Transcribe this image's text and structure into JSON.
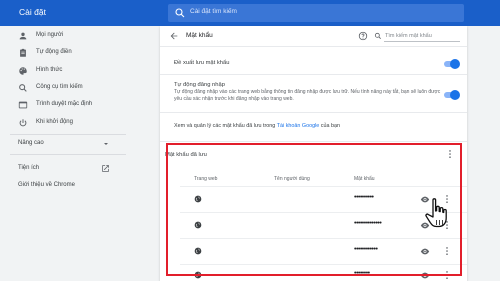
{
  "app": {
    "title": "Cài đặt"
  },
  "search": {
    "placeholder": "Cài đặt tìm kiếm"
  },
  "sidebar": {
    "items": [
      {
        "label": "Mọi người",
        "icon": "person-icon"
      },
      {
        "label": "Tự động điền",
        "icon": "clipboard-icon"
      },
      {
        "label": "Hình thức",
        "icon": "palette-icon"
      },
      {
        "label": "Công cụ tìm kiếm",
        "icon": "search-icon"
      },
      {
        "label": "Trình duyệt mặc định",
        "icon": "browser-icon"
      },
      {
        "label": "Khi khởi động",
        "icon": "power-icon"
      }
    ],
    "advanced": "Nâng cao",
    "extensions": "Tiện ích",
    "about": "Giới thiệu về Chrome"
  },
  "passwords": {
    "title": "Mật khẩu",
    "search_placeholder": "Tìm kiếm mật khẩu",
    "offer_save": "Đề xuất lưu mật khẩu",
    "auto_signin": "Tự động đăng nhập",
    "auto_signin_desc": "Tự động đăng nhập vào các trang web bằng thông tin đăng nhập được lưu trữ. Nếu tính năng này tắt, bạn sẽ luôn được yêu cầu xác nhận trước khi đăng nhập vào trang web.",
    "manage_prefix": "Xem và quản lý các mật khẩu đã lưu trong ",
    "manage_link": "Tài khoản Google",
    "manage_suffix": " của bạn",
    "saved_title": "Mật khẩu đã lưu",
    "columns": {
      "site": "Trang web",
      "username": "Tên người dùng",
      "password": "Mật khẩu"
    },
    "rows": [
      {
        "password": "••••••••••"
      },
      {
        "password": "••••••••••••••"
      },
      {
        "password": "••••••••••••"
      },
      {
        "password": "••••••••"
      }
    ]
  },
  "colors": {
    "header": "#1a5fc9",
    "accent": "#1a73e8",
    "highlight": "#e21e2b"
  }
}
